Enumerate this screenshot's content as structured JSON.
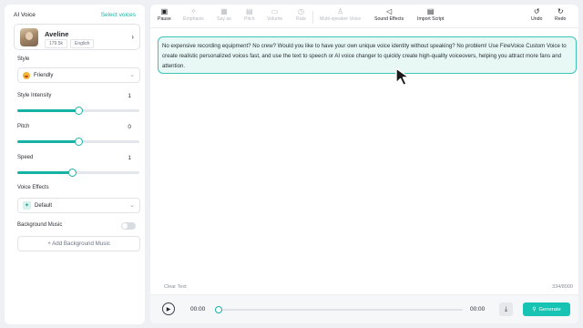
{
  "left_panel": {
    "title": "AI Voice",
    "select_voices": "Select voices",
    "voice": {
      "name": "Aveline",
      "tags": [
        "179.5k",
        "English"
      ]
    },
    "style": {
      "label": "Style",
      "value": "Friendly"
    },
    "style_intensity": {
      "label": "Style Intensity",
      "value": "1",
      "level": 0.5
    },
    "pitch": {
      "label": "Pitch",
      "value": "0",
      "level": 0.5
    },
    "speed": {
      "label": "Speed",
      "value": "1",
      "level": 0.45
    },
    "voice_effects": {
      "label": "Voice Effects",
      "value": "Default"
    },
    "background_music": {
      "label": "Background Music",
      "enabled": false,
      "add_label": "+ Add Background Music"
    }
  },
  "toolbar": {
    "items": [
      {
        "label": "Pause",
        "icon": "pause-icon",
        "enabled": true
      },
      {
        "label": "Emphasis",
        "icon": "emphasis-icon",
        "enabled": false
      },
      {
        "label": "Say as",
        "icon": "say-as-icon",
        "enabled": false
      },
      {
        "label": "Pitch",
        "icon": "pitch-icon",
        "enabled": false
      },
      {
        "label": "Volume",
        "icon": "volume-icon",
        "enabled": false
      },
      {
        "label": "Rate",
        "icon": "rate-icon",
        "enabled": false
      },
      {
        "label": "Multi-speaker Voice",
        "icon": "speaker-icon",
        "enabled": false
      },
      {
        "label": "Sound Effects",
        "icon": "sound-effects-icon",
        "enabled": true
      },
      {
        "label": "Import Script",
        "icon": "import-icon",
        "enabled": true
      }
    ],
    "undo": "Undo",
    "redo": "Redo"
  },
  "editor": {
    "text": "No expensive recording equipment? No crew? Would you like to have your own unique voice identity without speaking? No problem! Use FineVoice Custom Voice to create realistic personalized voices fast, and use the text to speech or AI voice changer to quickly create high-quality voiceovers, helping you attract more fans and attention.",
    "clear_text": "Clear Text",
    "counter": "334/8000"
  },
  "player": {
    "current_time": "00:00",
    "total_time": "00:00",
    "generate_label": "Generate"
  },
  "colors": {
    "accent": "#16b3a5",
    "text_block_bg": "#e7f8f5"
  }
}
